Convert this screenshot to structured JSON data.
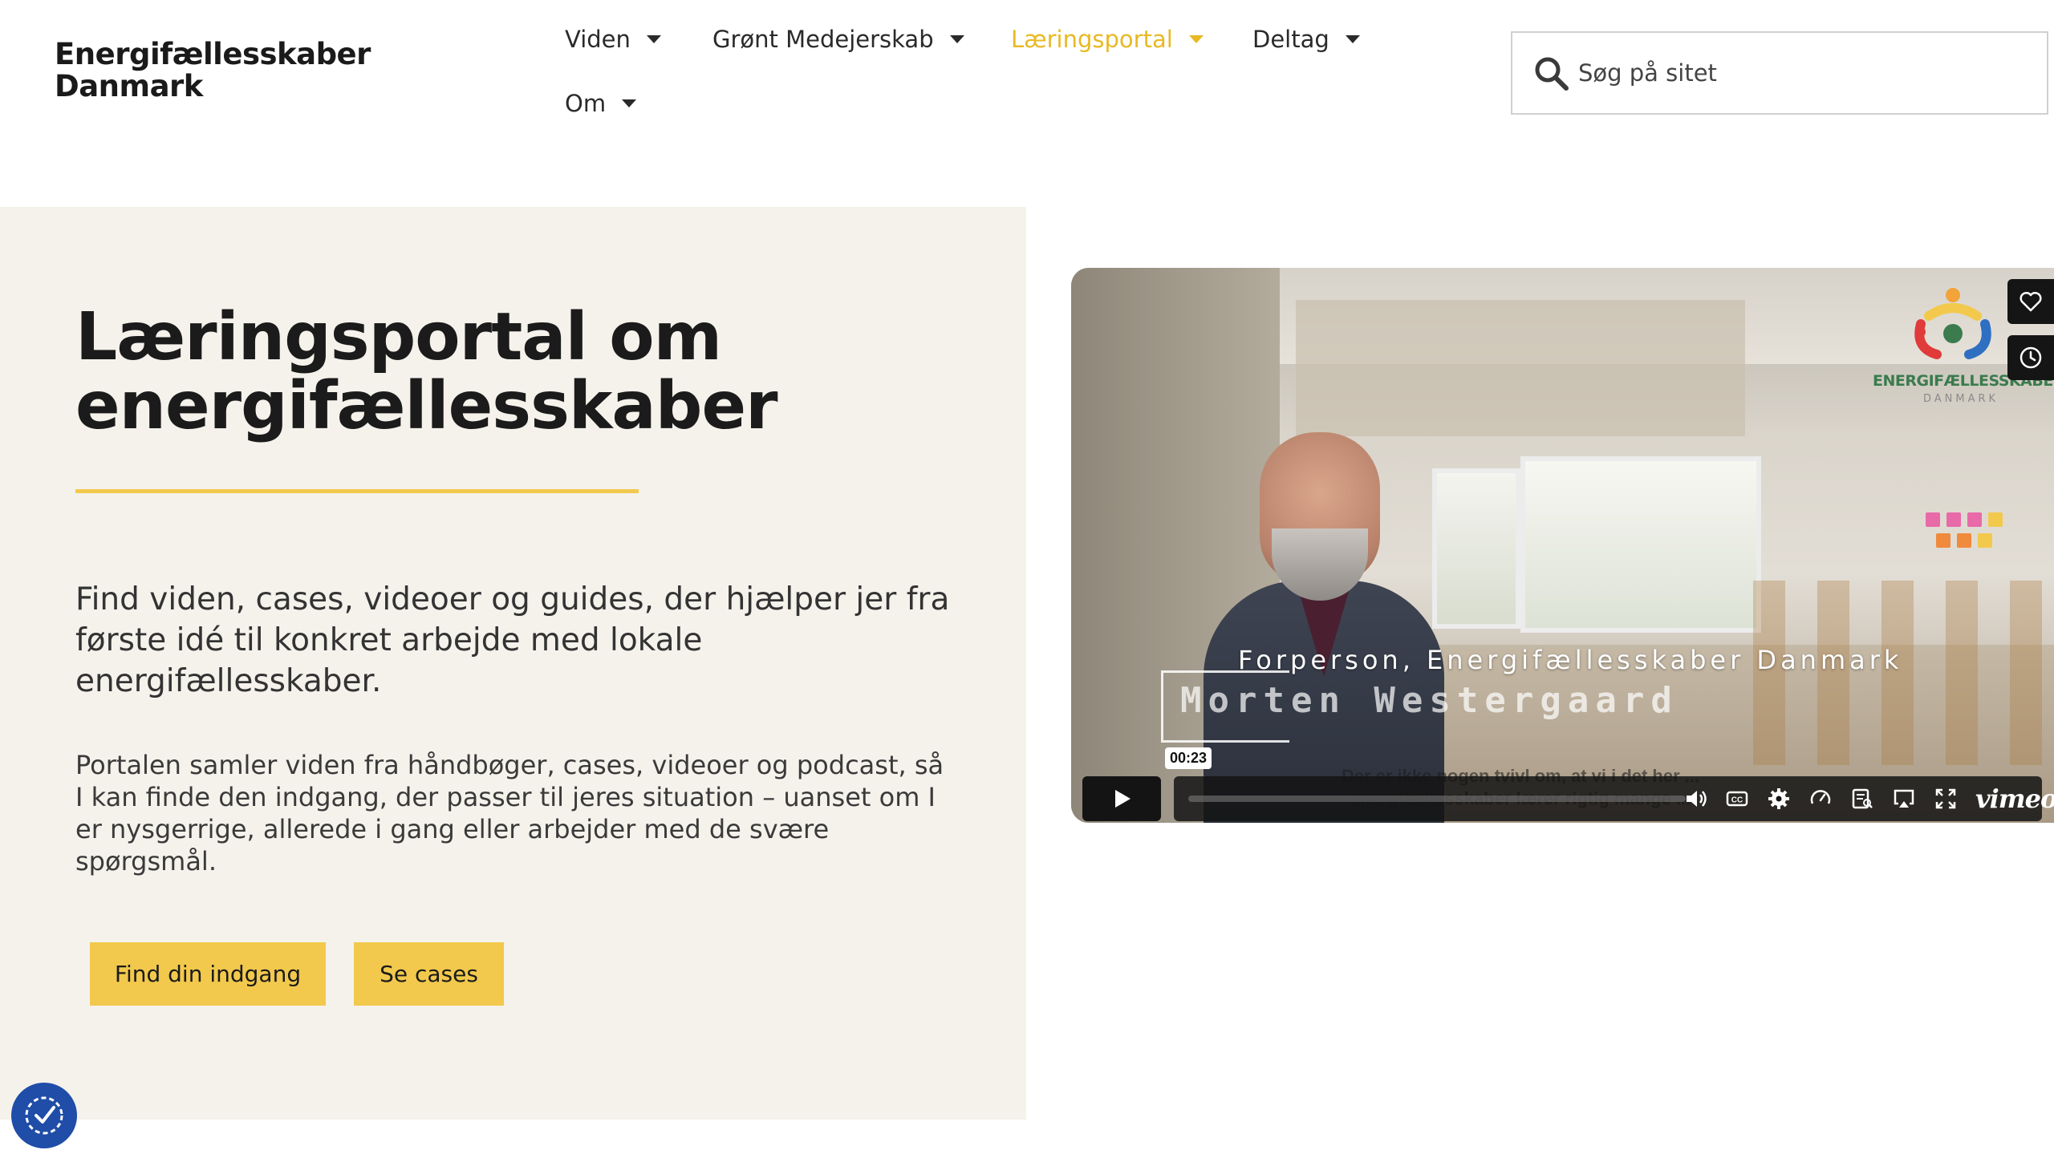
{
  "header": {
    "logo_line1": "Energifællesskaber",
    "logo_line2": "Danmark",
    "nav": [
      {
        "label": "Viden",
        "active": false
      },
      {
        "label": "Grønt Medejerskab",
        "active": false
      },
      {
        "label": "Læringsportal",
        "active": true
      },
      {
        "label": "Deltag",
        "active": false
      },
      {
        "label": "Om",
        "active": false
      }
    ],
    "search": {
      "placeholder": "Søg på sitet",
      "value": ""
    }
  },
  "hero": {
    "title": "Læringsportal om energifællesskaber",
    "lead": "Find viden, cases, videoer og guides, der hjælper jer fra første idé til konkret arbejde med lokale energifællesskaber.",
    "body": "Portalen samler viden fra håndbøger, cases, videoer og podcast, så I kan finde den indgang, der passer til jeres situation – uanset om I er nysgerrige, allerede i gang eller arbejder med de svære spørgsmål.",
    "buttons": {
      "primary": "Find din indgang",
      "secondary": "Se cases"
    }
  },
  "video": {
    "logo_text": "ENERGIFÆLLESSKABER",
    "logo_sub": "DANMARK",
    "caption_role": "Forperson, Energifællesskaber Danmark",
    "caption_name": "Morten Westergaard",
    "subtitle": "Der er ikke nogen tvivl om, at vi i det her ... energifællesskaber lærer rigtig mange ...",
    "timecode": "00:23",
    "brand": "vimeo",
    "controls": [
      "volume-icon",
      "captions-icon",
      "settings-icon",
      "speed-icon",
      "transcript-icon",
      "airplay-icon",
      "fullscreen-icon"
    ],
    "side_actions": [
      "heart-icon",
      "clock-icon"
    ]
  },
  "colors": {
    "accent": "#f2c94c",
    "active_nav": "#e8b923",
    "panel_bg": "#f5f2ec",
    "cookie_badge": "#1f4da8"
  }
}
